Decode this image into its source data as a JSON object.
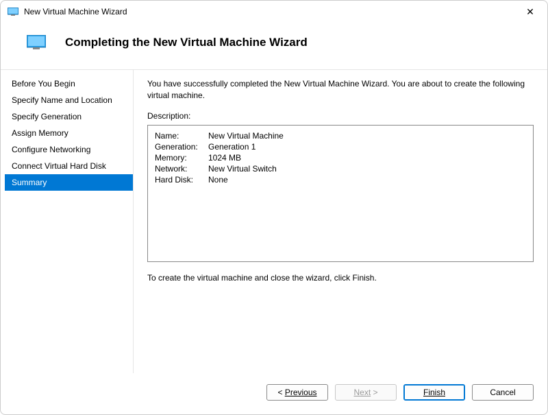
{
  "window": {
    "title": "New Virtual Machine Wizard"
  },
  "header": {
    "title": "Completing the New Virtual Machine Wizard"
  },
  "sidebar": {
    "items": [
      {
        "label": "Before You Begin"
      },
      {
        "label": "Specify Name and Location"
      },
      {
        "label": "Specify Generation"
      },
      {
        "label": "Assign Memory"
      },
      {
        "label": "Configure Networking"
      },
      {
        "label": "Connect Virtual Hard Disk"
      },
      {
        "label": "Summary"
      }
    ],
    "selected_index": 6
  },
  "main": {
    "intro": "You have successfully completed the New Virtual Machine Wizard. You are about to create the following virtual machine.",
    "description_label": "Description:",
    "summary": [
      {
        "key": "Name:",
        "value": "New Virtual Machine"
      },
      {
        "key": "Generation:",
        "value": "Generation 1"
      },
      {
        "key": "Memory:",
        "value": "1024 MB"
      },
      {
        "key": "Network:",
        "value": "New Virtual Switch"
      },
      {
        "key": "Hard Disk:",
        "value": "None"
      }
    ],
    "closing": "To create the virtual machine and close the wizard, click Finish."
  },
  "buttons": {
    "previous_prefix": "< ",
    "previous": "Previous",
    "next": "Next",
    "next_suffix": " >",
    "finish": "Finish",
    "cancel": "Cancel"
  }
}
